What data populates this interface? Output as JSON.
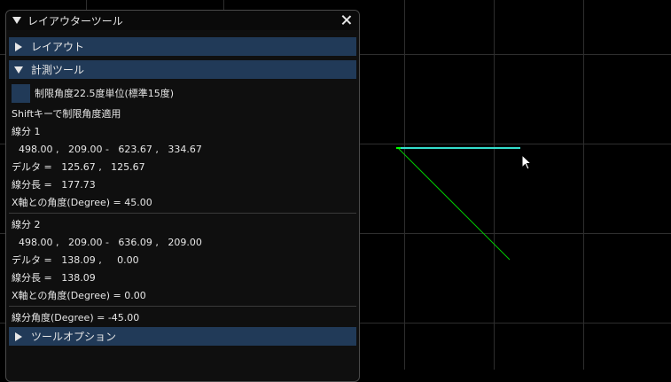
{
  "window": {
    "title": "レイアウターツール"
  },
  "sections": {
    "layout": "レイアウト",
    "measure": "計測ツール",
    "tool_options": "ツールオプション"
  },
  "measure": {
    "snap_checkbox_label": "制限角度22.5度単位(標準15度)",
    "shift_hint": "Shiftキーで制限角度適用",
    "segment1": {
      "title": "線分 1",
      "coords": "498.00 ,   209.00 -   623.67 ,   334.67",
      "delta": "デルタ =   125.67 ,   125.67",
      "length": "線分長 =   177.73",
      "angle": "X軸との角度(Degree) = 45.00"
    },
    "segment2": {
      "title": "線分 2",
      "coords": "498.00 ,   209.00 -   636.09 ,   209.00",
      "delta": "デルタ =   138.09 ,     0.00",
      "length": "線分長 =   138.09",
      "angle": "X軸との角度(Degree) = 0.00"
    },
    "between_angle": "線分角度(Degree) = -45.00"
  },
  "colors": {
    "grid": "#2e2e2e",
    "segment1": "#00cc00",
    "segment2": "#33ddcc",
    "header": "#213a58"
  }
}
